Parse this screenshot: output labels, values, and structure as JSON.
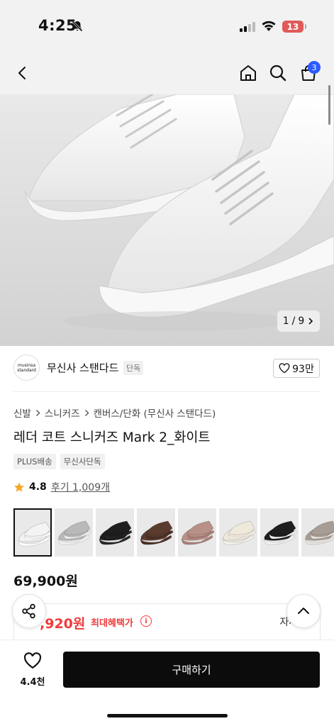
{
  "status_bar": {
    "time": "4:25",
    "battery": "13"
  },
  "nav": {
    "cart_count": "3"
  },
  "gallery": {
    "current": "1",
    "separator": "/",
    "total": "9"
  },
  "brand": {
    "logo_line1": "musinsa",
    "logo_line2": "standard",
    "name": "무신사 스탠다드",
    "tag": "단독",
    "likes": "93만"
  },
  "breadcrumb": [
    "신발",
    "스니커즈",
    "캔버스/단화 (무신사 스탠다드)"
  ],
  "product": {
    "title": "레더 코트 스니커즈 Mark 2_화이트",
    "tags": [
      "PLUS배송",
      "무신사단독"
    ],
    "rating": "4.8",
    "reviews": "후기 1,009개",
    "price": "69,900원",
    "benefit_price": ",920원",
    "benefit_label": "최대혜택가",
    "info": "i",
    "detail": "자세히"
  },
  "thumbnails": [
    {
      "name": "white",
      "color": "#f4f4f4",
      "sole": "#ffffff"
    },
    {
      "name": "silver",
      "color": "#b9b9b9",
      "sole": "#f2f2f2"
    },
    {
      "name": "black",
      "color": "#1e1e1e",
      "sole": "#262626"
    },
    {
      "name": "brown",
      "color": "#5a3b2e",
      "sole": "#4a2f24"
    },
    {
      "name": "pink",
      "color": "#b89088",
      "sole": "#a88078"
    },
    {
      "name": "cream",
      "color": "#efe9dc",
      "sole": "#f6f2e8"
    },
    {
      "name": "black-white",
      "color": "#1e1e1e",
      "sole": "#f2f2f2"
    },
    {
      "name": "grey",
      "color": "#a89d94",
      "sole": "#e8e4e0"
    }
  ],
  "bottom": {
    "wish_count": "4.4천",
    "buy_label": "구매하기"
  },
  "icons": [
    "back-icon",
    "home-icon",
    "search-icon",
    "shopping-bag-icon",
    "heart-icon",
    "share-icon",
    "chevron-up-icon",
    "star-icon",
    "chevron-right-icon"
  ],
  "colors": {
    "accent_red": "#f03b3b",
    "badge_blue": "#2d5bff",
    "star": "#f5a623",
    "buy_button": "#0c0c0c"
  }
}
